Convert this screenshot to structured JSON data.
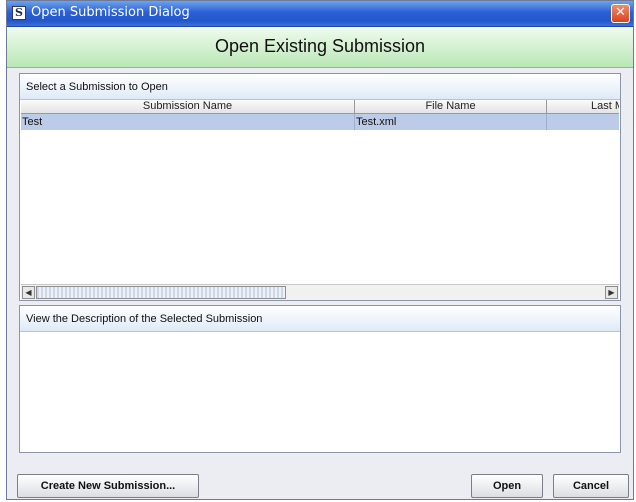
{
  "window": {
    "title": "Open Submission Dialog",
    "icon_letter": "S",
    "close_glyph": "✕"
  },
  "header": {
    "title": "Open Existing Submission"
  },
  "submissions_panel": {
    "label": "Select a Submission to Open",
    "columns": [
      "Submission Name",
      "File Name",
      "Last M"
    ],
    "rows": [
      {
        "cells": [
          "Test",
          "Test.xml",
          ""
        ]
      }
    ]
  },
  "description_panel": {
    "label": "View the Description of the Selected Submission"
  },
  "buttons": {
    "create": "Create New Submission...",
    "open": "Open",
    "cancel": "Cancel"
  },
  "colors": {
    "title_bar": "#2c5fd4",
    "header_band": "#b9e7b5",
    "selected_row": "#bccbe7"
  }
}
